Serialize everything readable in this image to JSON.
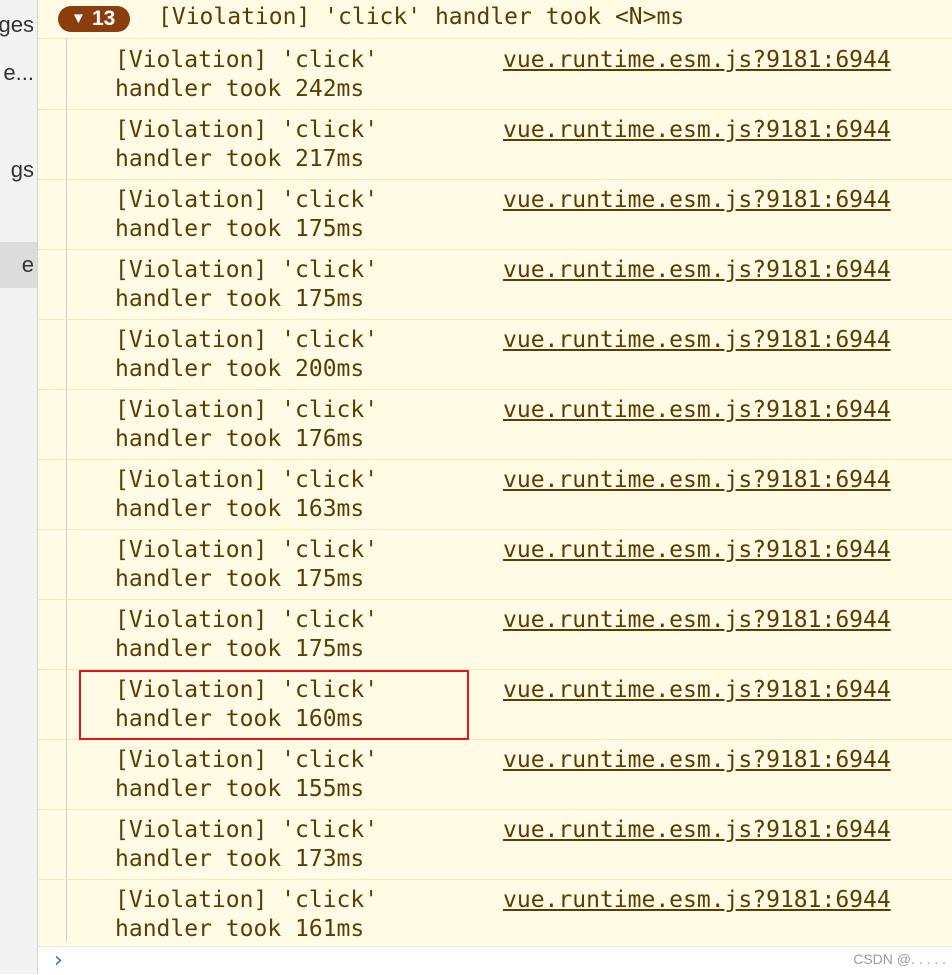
{
  "sidebar": {
    "items": [
      {
        "label": "ges"
      },
      {
        "label": "e..."
      },
      {
        "label": "gs"
      },
      {
        "label": "e"
      }
    ]
  },
  "group": {
    "count": "13",
    "title": "[Violation] 'click' handler took <N>ms"
  },
  "messages": [
    {
      "line1": "[Violation] 'click'",
      "line2": "handler took 242ms",
      "source": "vue.runtime.esm.js?9181:6944"
    },
    {
      "line1": "[Violation] 'click'",
      "line2": "handler took 217ms",
      "source": "vue.runtime.esm.js?9181:6944"
    },
    {
      "line1": "[Violation] 'click'",
      "line2": "handler took 175ms",
      "source": "vue.runtime.esm.js?9181:6944"
    },
    {
      "line1": "[Violation] 'click'",
      "line2": "handler took 175ms",
      "source": "vue.runtime.esm.js?9181:6944"
    },
    {
      "line1": "[Violation] 'click'",
      "line2": "handler took 200ms",
      "source": "vue.runtime.esm.js?9181:6944"
    },
    {
      "line1": "[Violation] 'click'",
      "line2": "handler took 176ms",
      "source": "vue.runtime.esm.js?9181:6944"
    },
    {
      "line1": "[Violation] 'click'",
      "line2": "handler took 163ms",
      "source": "vue.runtime.esm.js?9181:6944"
    },
    {
      "line1": "[Violation] 'click'",
      "line2": "handler took 175ms",
      "source": "vue.runtime.esm.js?9181:6944"
    },
    {
      "line1": "[Violation] 'click'",
      "line2": "handler took 175ms",
      "source": "vue.runtime.esm.js?9181:6944"
    },
    {
      "line1": "[Violation] 'click'",
      "line2": "handler took 160ms",
      "source": "vue.runtime.esm.js?9181:6944"
    },
    {
      "line1": "[Violation] 'click'",
      "line2": "handler took 155ms",
      "source": "vue.runtime.esm.js?9181:6944"
    },
    {
      "line1": "[Violation] 'click'",
      "line2": "handler took 173ms",
      "source": "vue.runtime.esm.js?9181:6944"
    },
    {
      "line1": "[Violation] 'click'",
      "line2": "handler took 161ms",
      "source": "vue.runtime.esm.js?9181:6944"
    }
  ],
  "prompt": {
    "arrow": "›"
  },
  "watermark": "CSDN @. . . . .",
  "colors": {
    "warning_bg": "#fffbe5",
    "warning_text": "#5c3c00",
    "badge_bg": "#8a3d0d",
    "highlight_border": "#e0161b",
    "prompt_arrow": "#2f6fd6"
  }
}
